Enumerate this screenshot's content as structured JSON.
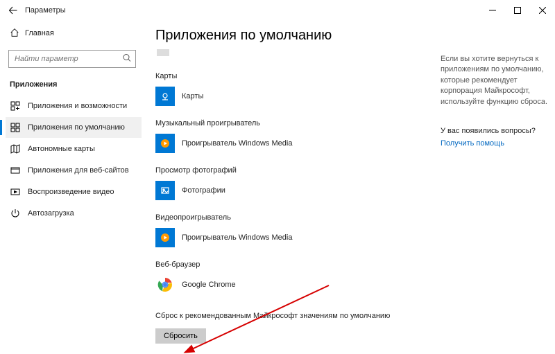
{
  "titlebar": {
    "title": "Параметры"
  },
  "sidebar": {
    "home": "Главная",
    "search_placeholder": "Найти параметр",
    "section": "Приложения",
    "items": [
      {
        "label": "Приложения и возможности"
      },
      {
        "label": "Приложения по умолчанию"
      },
      {
        "label": "Автономные карты"
      },
      {
        "label": "Приложения для веб-сайтов"
      },
      {
        "label": "Воспроизведение видео"
      },
      {
        "label": "Автозагрузка"
      }
    ]
  },
  "main": {
    "page_title": "Приложения по умолчанию",
    "groups": [
      {
        "label": "Карты",
        "app": "Карты",
        "icon": "maps"
      },
      {
        "label": "Музыкальный проигрыватель",
        "app": "Проигрыватель Windows Media",
        "icon": "wmp"
      },
      {
        "label": "Просмотр фотографий",
        "app": "Фотографии",
        "icon": "photos"
      },
      {
        "label": "Видеопроигрыватель",
        "app": "Проигрыватель Windows Media",
        "icon": "wmp"
      },
      {
        "label": "Веб-браузер",
        "app": "Google Chrome",
        "icon": "chrome"
      }
    ],
    "reset_section_label": "Сброс к рекомендованным Майкрософт значениям по умолчанию",
    "reset_button": "Сбросить"
  },
  "help": {
    "text": "Если вы хотите вернуться к приложениям по умолчанию, которые рекомендует корпорация Майкрософт, используйте функцию сброса.",
    "question": "У вас появились вопросы?",
    "link": "Получить помощь"
  }
}
